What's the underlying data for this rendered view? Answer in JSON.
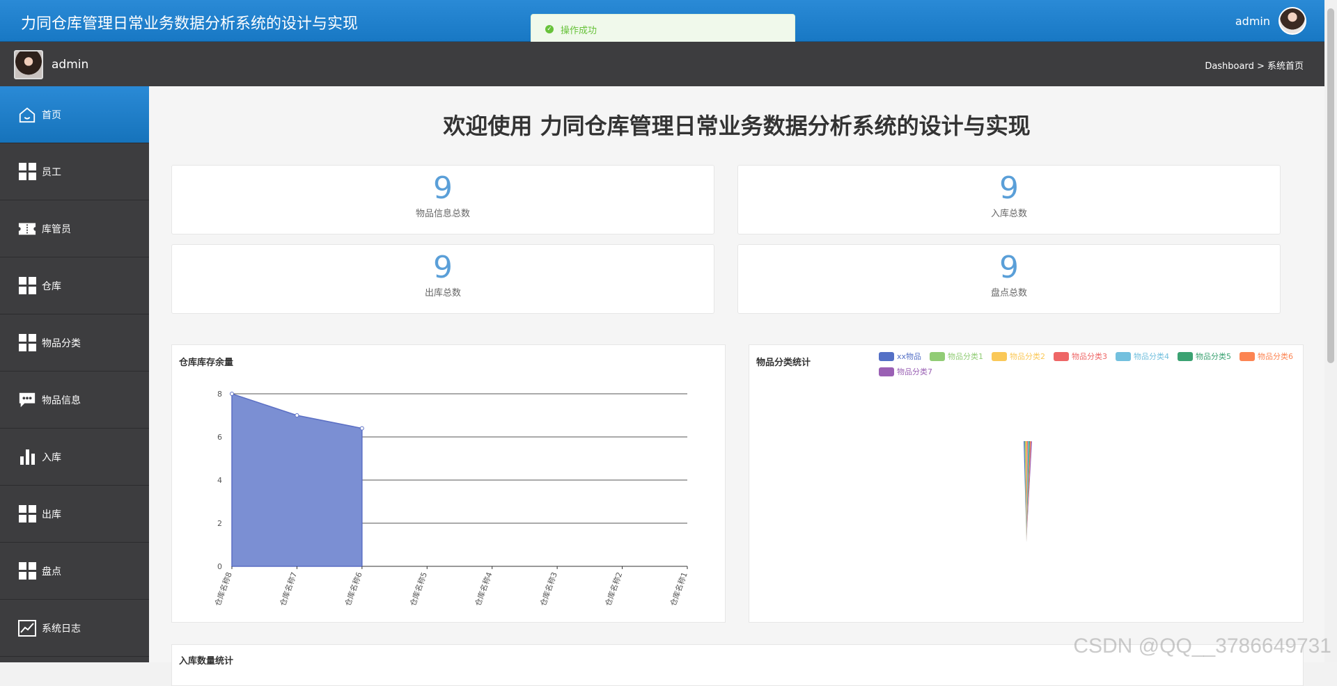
{
  "header": {
    "title": "力同仓库管理日常业务数据分析系统的设计与实现",
    "user": "admin"
  },
  "toast": {
    "message": "操作成功"
  },
  "subheader": {
    "user": "admin",
    "breadcrumb": "Dashboard > 系统首页"
  },
  "sidebar": {
    "items": [
      {
        "label": "首页",
        "icon": "home-icon"
      },
      {
        "label": "员工",
        "icon": "grid-icon"
      },
      {
        "label": "库管员",
        "icon": "ticket-icon"
      },
      {
        "label": "仓库",
        "icon": "grid-icon"
      },
      {
        "label": "物品分类",
        "icon": "grid-icon"
      },
      {
        "label": "物品信息",
        "icon": "chat-icon"
      },
      {
        "label": "入库",
        "icon": "bar-chart-icon"
      },
      {
        "label": "出库",
        "icon": "grid-icon"
      },
      {
        "label": "盘点",
        "icon": "grid-icon"
      },
      {
        "label": "系统日志",
        "icon": "line-chart-icon"
      }
    ]
  },
  "main": {
    "welcome": "欢迎使用 力同仓库管理日常业务数据分析系统的设计与实现",
    "stats": [
      {
        "value": "9",
        "label": "物品信息总数"
      },
      {
        "value": "9",
        "label": "入库总数"
      },
      {
        "value": "9",
        "label": "出库总数"
      },
      {
        "value": "9",
        "label": "盘点总数"
      }
    ],
    "bottom_panel_title": "入库数量统计"
  },
  "colors": {
    "accent": "#1878c4",
    "sidebar": "#3d3d3f",
    "stat_number": "#5a9fd8",
    "area_fill": "#7b8fd3"
  },
  "watermark": "CSDN @QQ__3786649731",
  "chart_data": [
    {
      "type": "area",
      "title": "仓库库存余量",
      "categories": [
        "仓库名称8",
        "仓库名称7",
        "仓库名称6",
        "仓库名称5",
        "仓库名称4",
        "仓库名称3",
        "仓库名称2",
        "仓库名称1"
      ],
      "values": [
        8,
        7,
        6.4,
        null,
        null,
        null,
        null,
        null
      ],
      "ylim": [
        0,
        8
      ],
      "yticks": [
        0,
        2,
        4,
        6,
        8
      ],
      "grid": true
    },
    {
      "type": "pie",
      "title": "物品分类统计",
      "legend": [
        "xx物品",
        "物品分类1",
        "物品分类2",
        "物品分类3",
        "物品分类4",
        "物品分类5",
        "物品分类6",
        "物品分类7"
      ],
      "colors": [
        "#5470c6",
        "#91cc75",
        "#fac858",
        "#ee6666",
        "#73c0de",
        "#3ba272",
        "#fc8452",
        "#9a60b4"
      ],
      "values": [
        1,
        1,
        1,
        1,
        1,
        1,
        1,
        1
      ],
      "legend_position": "top"
    }
  ]
}
